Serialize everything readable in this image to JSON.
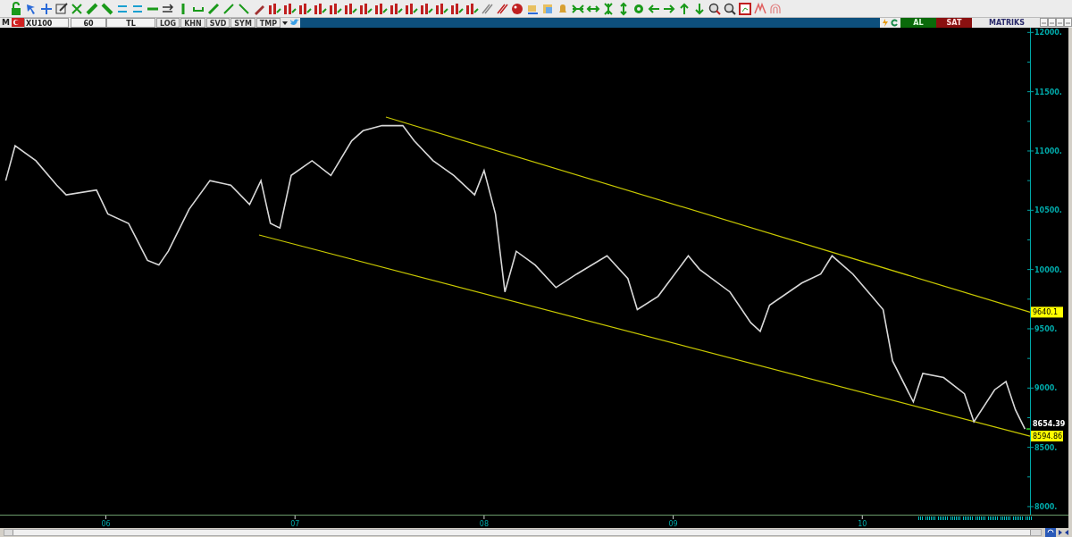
{
  "header": {
    "mode_letter": "M",
    "symbol": "XU100",
    "period": "60",
    "currency": "TL",
    "toggles": [
      {
        "label": "LOG"
      },
      {
        "label": "KHN"
      },
      {
        "label": "SVD"
      },
      {
        "label": "SYM"
      },
      {
        "label": "TMP"
      }
    ],
    "buy_label": "AL",
    "sell_label": "SAT",
    "brand": "MATRIKS"
  },
  "chart": {
    "price_labels": [
      {
        "kind": "badge",
        "text": "9640.1"
      },
      {
        "kind": "last",
        "text": "8654.39"
      },
      {
        "kind": "badge",
        "text": "8594.86"
      }
    ],
    "chart_data": {
      "type": "line",
      "x": [
        5.47,
        5.52,
        5.63,
        5.74,
        5.79,
        5.95,
        6.01,
        6.12,
        6.22,
        6.28,
        6.33,
        6.44,
        6.55,
        6.66,
        6.76,
        6.82,
        6.87,
        6.92,
        6.98,
        7.09,
        7.19,
        7.3,
        7.36,
        7.46,
        7.57,
        7.63,
        7.73,
        7.84,
        7.95,
        8.0,
        8.06,
        8.11,
        8.17,
        8.27,
        8.38,
        8.49,
        8.65,
        8.76,
        8.81,
        8.92,
        9.08,
        9.14,
        9.3,
        9.41,
        9.46,
        9.51,
        9.68,
        9.78,
        9.84,
        9.95,
        10.05,
        10.11,
        10.16,
        10.27,
        10.32,
        10.43,
        10.54,
        10.59,
        10.7,
        10.76,
        10.81,
        10.86
      ],
      "series": [
        {
          "color": "#d8d8d8",
          "values": [
            10750,
            11044,
            10918,
            10711,
            10630,
            10671,
            10469,
            10389,
            10077,
            10038,
            10154,
            10509,
            10750,
            10711,
            10549,
            10750,
            10389,
            10350,
            10794,
            10918,
            10794,
            11086,
            11171,
            11214,
            11214,
            11086,
            10918,
            10794,
            10630,
            10835,
            10469,
            9811,
            10154,
            10038,
            9848,
            9962,
            10116,
            9924,
            9662,
            9774,
            10116,
            10000,
            9811,
            9552,
            9479,
            9699,
            9886,
            9962,
            10116,
            9962,
            9774,
            9662,
            9229,
            8883,
            9124,
            9089,
            8952,
            8716,
            8986,
            9055,
            8816,
            8654
          ]
        }
      ],
      "xlim": [
        5.44,
        11.09
      ],
      "ylim": [
        7932,
        12040
      ],
      "xticks": [
        {
          "value": 6,
          "label": "06"
        },
        {
          "value": 7,
          "label": "07"
        },
        {
          "value": 8,
          "label": "08"
        },
        {
          "value": 9,
          "label": "09"
        },
        {
          "value": 10,
          "label": "10"
        }
      ],
      "yticks": [
        {
          "value": 12000,
          "label": "12000."
        },
        {
          "value": 11500,
          "label": "11500."
        },
        {
          "value": 11000,
          "label": "11000."
        },
        {
          "value": 10500,
          "label": "10500."
        },
        {
          "value": 10000,
          "label": "10000."
        },
        {
          "value": 9500,
          "label": "9500."
        },
        {
          "value": 9000,
          "label": "9000."
        },
        {
          "value": 8500,
          "label": "8500."
        },
        {
          "value": 8000,
          "label": "8000."
        }
      ]
    }
  }
}
